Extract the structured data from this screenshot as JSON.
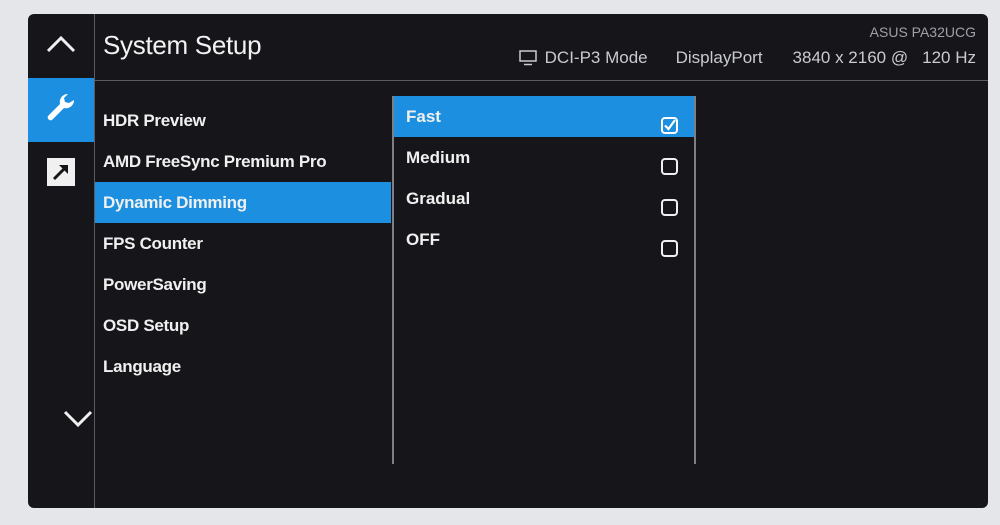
{
  "header": {
    "title": "System Setup",
    "model": "ASUS PA32UCG",
    "mode": "DCI-P3 Mode",
    "input": "DisplayPort",
    "resolution": "3840 x 2160 @",
    "refresh": "120 Hz"
  },
  "nav": {
    "items": [
      {
        "icon": "chevron-up-icon",
        "active": false
      },
      {
        "icon": "wrench-icon",
        "active": true
      },
      {
        "icon": "shortcut-arrow-icon",
        "active": false
      }
    ]
  },
  "menu": {
    "items": [
      {
        "label": "HDR Preview"
      },
      {
        "label": "AMD FreeSync Premium Pro"
      },
      {
        "label": "Dynamic Dimming",
        "selected": true
      },
      {
        "label": "FPS Counter"
      },
      {
        "label": "PowerSaving"
      },
      {
        "label": "OSD Setup"
      },
      {
        "label": "Language"
      }
    ],
    "more_icon": "chevron-down-icon"
  },
  "submenu": {
    "options": [
      {
        "label": "Fast",
        "checked": true
      },
      {
        "label": "Medium",
        "checked": false
      },
      {
        "label": "Gradual",
        "checked": false
      },
      {
        "label": "OFF",
        "checked": false
      }
    ]
  },
  "colors": {
    "accent": "#1c8fe0",
    "background": "#15151a",
    "divider": "#5a5c62"
  }
}
